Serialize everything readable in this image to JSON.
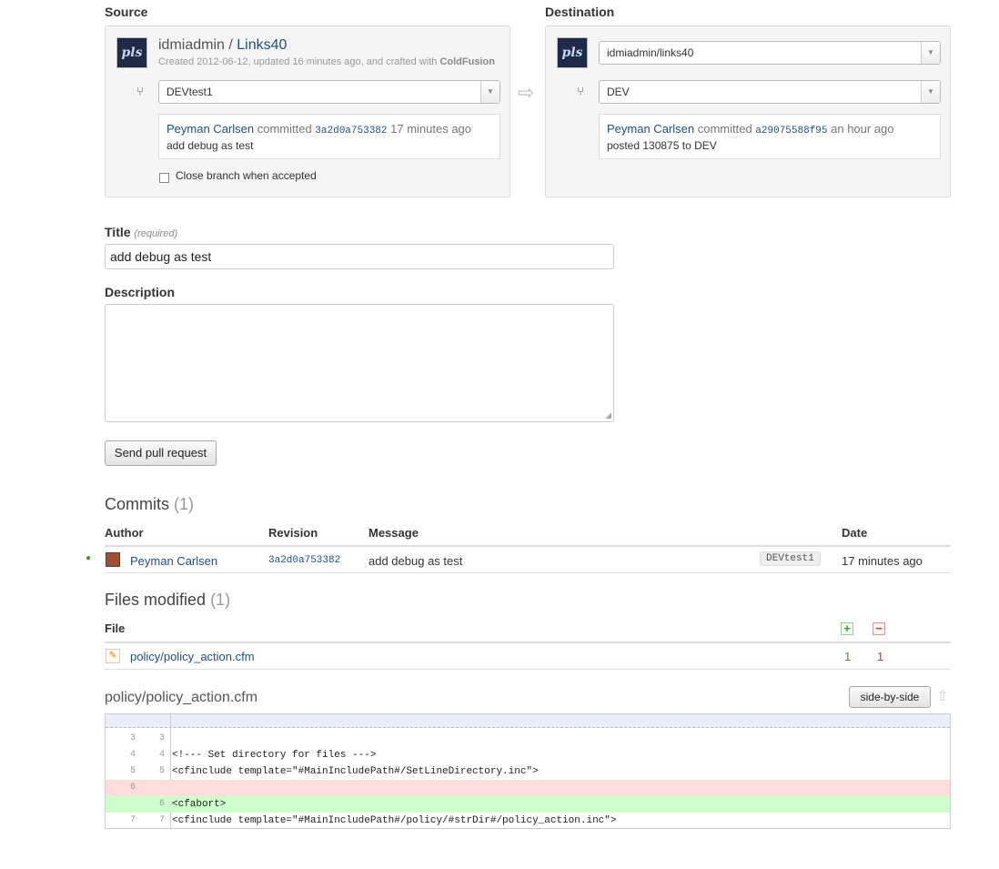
{
  "source": {
    "label": "Source",
    "avatar_text": "pls",
    "repo_owner": "idmiadmin",
    "repo_sep": " / ",
    "repo_name": "Links40",
    "meta_prefix": "Created 2012-06-12, updated 16 minutes ago, and crafted with ",
    "meta_lang": "ColdFusion",
    "branch": "DEVtest1",
    "commit": {
      "author": "Peyman Carlsen",
      "verb": " committed ",
      "hash": "3a2d0a753382",
      "when": " 17 minutes ago",
      "message": "add debug as test"
    },
    "close_branch_label": "Close branch when accepted"
  },
  "destination": {
    "label": "Destination",
    "avatar_text": "pls",
    "repo": "idmiadmin/links40",
    "branch": "DEV",
    "commit": {
      "author": "Peyman Carlsen",
      "verb": " committed ",
      "hash": "a29075588f95",
      "when": " an hour ago",
      "message": "posted 130875 to DEV"
    }
  },
  "form": {
    "title_label": "Title",
    "title_required": "(required)",
    "title_value": "add debug as test",
    "description_label": "Description",
    "description_value": "",
    "submit_label": "Send pull request"
  },
  "commits": {
    "heading": "Commits",
    "count": "(1)",
    "columns": [
      "Author",
      "Revision",
      "Message",
      "Date"
    ],
    "rows": [
      {
        "author": "Peyman Carlsen",
        "revision": "3a2d0a753382",
        "message": "add debug as test",
        "branch_tag": "DEVtest1",
        "date": "17 minutes ago"
      }
    ]
  },
  "files": {
    "heading": "Files modified",
    "count": "(1)",
    "column": "File",
    "add_icon": "+",
    "remove_icon": "−",
    "rows": [
      {
        "path": "policy/policy_action.cfm",
        "added": "1",
        "removed": "1"
      }
    ]
  },
  "diff": {
    "file": "policy/policy_action.cfm",
    "view_button": "side-by-side",
    "lines": [
      {
        "old": "3",
        "new": "3",
        "code": "",
        "type": "context"
      },
      {
        "old": "4",
        "new": "4",
        "code": "<!--- Set directory for files --->",
        "type": "context"
      },
      {
        "old": "5",
        "new": "5",
        "code": "<cfinclude template=\"#MainIncludePath#/SetLineDirectory.inc\">",
        "type": "context"
      },
      {
        "old": "6",
        "new": "",
        "code": "",
        "type": "removed"
      },
      {
        "old": "",
        "new": "6",
        "code": "<cfabort>",
        "type": "added"
      },
      {
        "old": "7",
        "new": "7",
        "code": "<cfinclude template=\"#MainIncludePath#/policy/#strDir#/policy_action.inc\">",
        "type": "context"
      }
    ]
  },
  "colors": {
    "link": "#205081",
    "removed_bg": "#ffdddd",
    "added_bg": "#ccffcc",
    "added_count": "#3c9d1a",
    "removed_count": "#c0392b"
  }
}
